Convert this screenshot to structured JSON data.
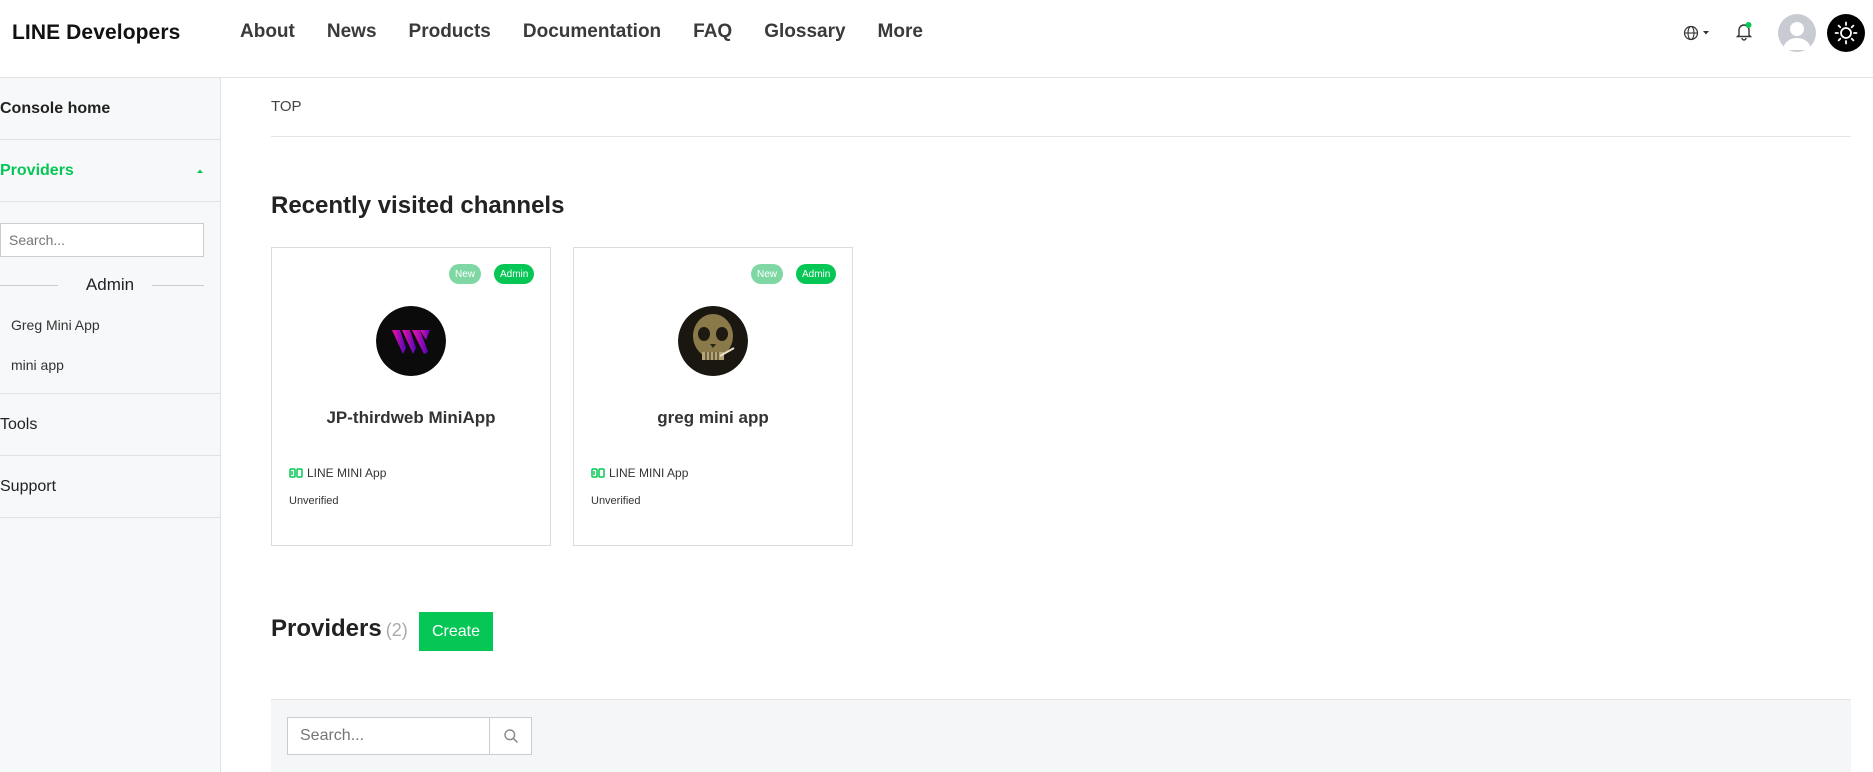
{
  "header": {
    "brand": "LINE Developers",
    "nav": [
      "About",
      "News",
      "Products",
      "Documentation",
      "FAQ",
      "Glossary",
      "More"
    ]
  },
  "sidebar": {
    "console_home": "Console home",
    "providers": "Providers",
    "search_placeholder": "Search...",
    "group_label": "Admin",
    "items": [
      "Greg Mini App",
      "mini app"
    ],
    "tools": "Tools",
    "support": "Support"
  },
  "main": {
    "breadcrumb": "TOP",
    "recent_title": "Recently visited channels",
    "cards": [
      {
        "name": "JP-thirdweb MiniApp",
        "badge_new": "New",
        "badge_admin": "Admin",
        "type": "LINE MINI App",
        "status": "Unverified"
      },
      {
        "name": "greg mini app",
        "badge_new": "New",
        "badge_admin": "Admin",
        "type": "LINE MINI App",
        "status": "Unverified"
      }
    ],
    "providers_title": "Providers",
    "providers_count": "(2)",
    "create_label": "Create",
    "search_placeholder": "Search..."
  },
  "colors": {
    "accent": "#06c755",
    "badge_new": "#7fd8a3"
  },
  "icons": [
    "globe-icon",
    "bell-icon",
    "avatar-icon",
    "sun-icon",
    "chevron-up-icon",
    "mini-app-icon",
    "search-icon"
  ]
}
